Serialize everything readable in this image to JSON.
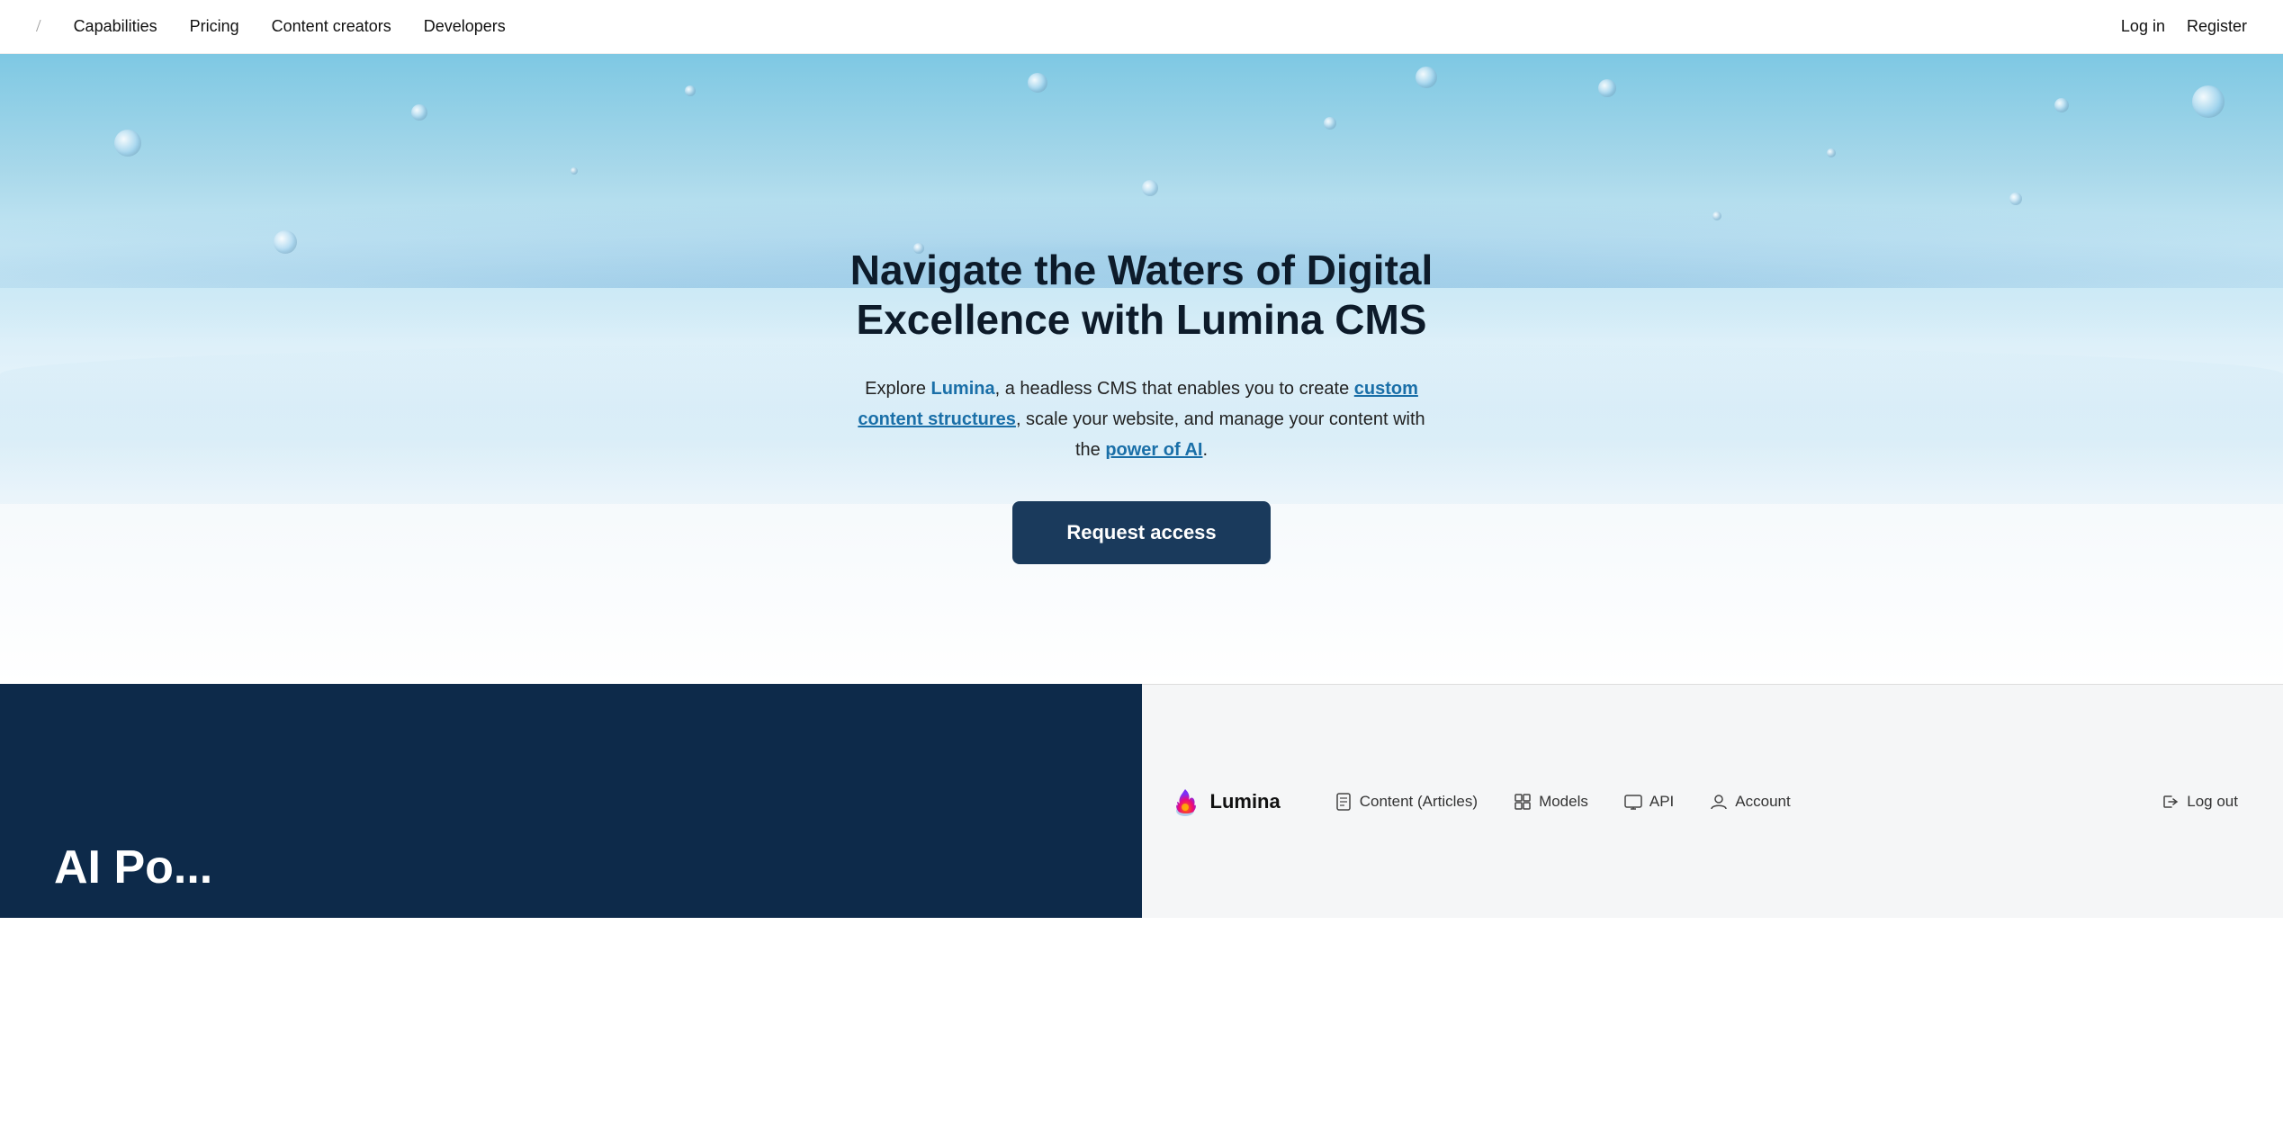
{
  "nav": {
    "slash": "/",
    "links": [
      "Capabilities",
      "Pricing",
      "Content creators",
      "Developers"
    ],
    "auth": [
      "Log in",
      "Register"
    ]
  },
  "hero": {
    "title": "Navigate the Waters of Digital Excellence with Lumina CMS",
    "subtitle_parts": {
      "before_lumina": "Explore ",
      "lumina": "Lumina",
      "after_lumina": ", a headless CMS that enables you to create ",
      "custom_content": "custom content structures",
      "after_custom": ", scale your website, and manage your content with the ",
      "power_ai": "power of AI",
      "period": "."
    },
    "cta_label": "Request access"
  },
  "bottom": {
    "section_title": "AI Po...",
    "section_title_display": "AI Po"
  },
  "appbar": {
    "logo_text": "Lumina",
    "nav_items": [
      {
        "label": "Content (Articles)",
        "icon": "document-icon"
      },
      {
        "label": "Models",
        "icon": "grid-icon"
      },
      {
        "label": "API",
        "icon": "monitor-icon"
      },
      {
        "label": "Account",
        "icon": "user-icon"
      }
    ],
    "logout_label": "Log out",
    "logout_icon": "logout-icon"
  }
}
